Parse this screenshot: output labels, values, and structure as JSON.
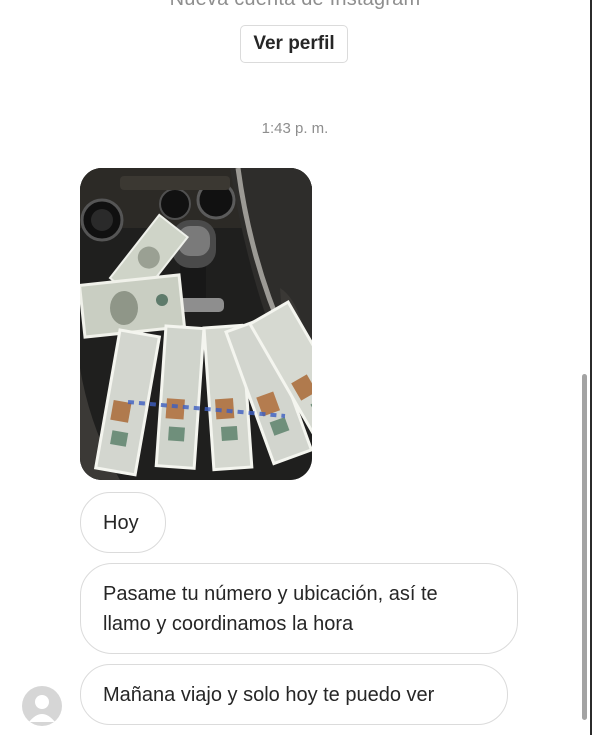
{
  "header": {
    "notice_text": "Nueva cuenta de Instagram",
    "profile_button_label": "Ver perfil"
  },
  "conversation": {
    "timestamp": "1:43 p. m.",
    "messages": [
      {
        "type": "image",
        "content": "photo of dollar bills on a car center console"
      },
      {
        "type": "text",
        "text": "Hoy"
      },
      {
        "type": "text",
        "lines": [
          "Pasame tu número y ubicación, así te",
          "llamo y coordinamos la hora"
        ]
      },
      {
        "type": "text",
        "text": "Mañana viajo y solo hoy te puedo ver"
      }
    ]
  },
  "sender": {
    "avatar_icon": "default-avatar-icon"
  },
  "colors": {
    "bubble_border": "#dbdbdb",
    "text": "#262626",
    "muted_text": "#8e8e8e",
    "avatar": "#d6d6d6",
    "scrollbar": "#a3a3a3"
  }
}
